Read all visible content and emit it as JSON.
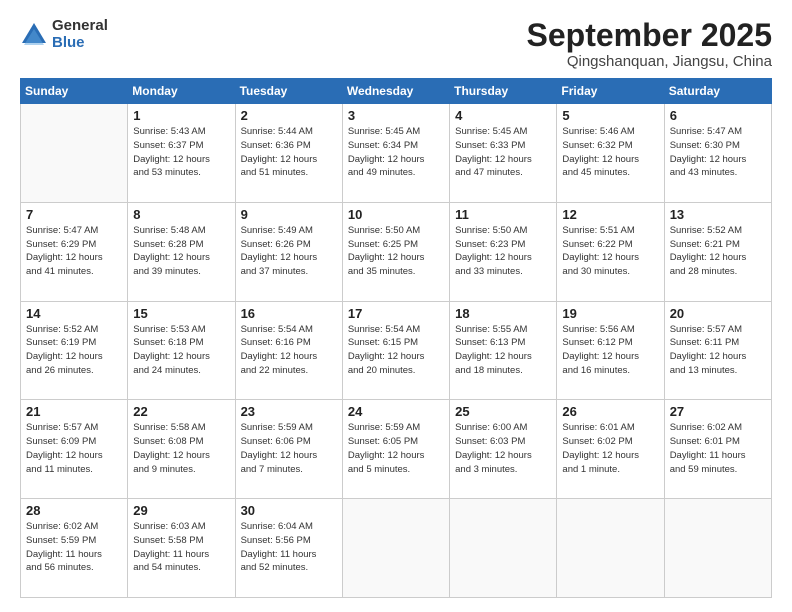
{
  "logo": {
    "general": "General",
    "blue": "Blue"
  },
  "title": {
    "month": "September 2025",
    "location": "Qingshanquan, Jiangsu, China"
  },
  "weekdays": [
    "Sunday",
    "Monday",
    "Tuesday",
    "Wednesday",
    "Thursday",
    "Friday",
    "Saturday"
  ],
  "weeks": [
    [
      {
        "day": "",
        "info": ""
      },
      {
        "day": "1",
        "info": "Sunrise: 5:43 AM\nSunset: 6:37 PM\nDaylight: 12 hours\nand 53 minutes."
      },
      {
        "day": "2",
        "info": "Sunrise: 5:44 AM\nSunset: 6:36 PM\nDaylight: 12 hours\nand 51 minutes."
      },
      {
        "day": "3",
        "info": "Sunrise: 5:45 AM\nSunset: 6:34 PM\nDaylight: 12 hours\nand 49 minutes."
      },
      {
        "day": "4",
        "info": "Sunrise: 5:45 AM\nSunset: 6:33 PM\nDaylight: 12 hours\nand 47 minutes."
      },
      {
        "day": "5",
        "info": "Sunrise: 5:46 AM\nSunset: 6:32 PM\nDaylight: 12 hours\nand 45 minutes."
      },
      {
        "day": "6",
        "info": "Sunrise: 5:47 AM\nSunset: 6:30 PM\nDaylight: 12 hours\nand 43 minutes."
      }
    ],
    [
      {
        "day": "7",
        "info": "Sunrise: 5:47 AM\nSunset: 6:29 PM\nDaylight: 12 hours\nand 41 minutes."
      },
      {
        "day": "8",
        "info": "Sunrise: 5:48 AM\nSunset: 6:28 PM\nDaylight: 12 hours\nand 39 minutes."
      },
      {
        "day": "9",
        "info": "Sunrise: 5:49 AM\nSunset: 6:26 PM\nDaylight: 12 hours\nand 37 minutes."
      },
      {
        "day": "10",
        "info": "Sunrise: 5:50 AM\nSunset: 6:25 PM\nDaylight: 12 hours\nand 35 minutes."
      },
      {
        "day": "11",
        "info": "Sunrise: 5:50 AM\nSunset: 6:23 PM\nDaylight: 12 hours\nand 33 minutes."
      },
      {
        "day": "12",
        "info": "Sunrise: 5:51 AM\nSunset: 6:22 PM\nDaylight: 12 hours\nand 30 minutes."
      },
      {
        "day": "13",
        "info": "Sunrise: 5:52 AM\nSunset: 6:21 PM\nDaylight: 12 hours\nand 28 minutes."
      }
    ],
    [
      {
        "day": "14",
        "info": "Sunrise: 5:52 AM\nSunset: 6:19 PM\nDaylight: 12 hours\nand 26 minutes."
      },
      {
        "day": "15",
        "info": "Sunrise: 5:53 AM\nSunset: 6:18 PM\nDaylight: 12 hours\nand 24 minutes."
      },
      {
        "day": "16",
        "info": "Sunrise: 5:54 AM\nSunset: 6:16 PM\nDaylight: 12 hours\nand 22 minutes."
      },
      {
        "day": "17",
        "info": "Sunrise: 5:54 AM\nSunset: 6:15 PM\nDaylight: 12 hours\nand 20 minutes."
      },
      {
        "day": "18",
        "info": "Sunrise: 5:55 AM\nSunset: 6:13 PM\nDaylight: 12 hours\nand 18 minutes."
      },
      {
        "day": "19",
        "info": "Sunrise: 5:56 AM\nSunset: 6:12 PM\nDaylight: 12 hours\nand 16 minutes."
      },
      {
        "day": "20",
        "info": "Sunrise: 5:57 AM\nSunset: 6:11 PM\nDaylight: 12 hours\nand 13 minutes."
      }
    ],
    [
      {
        "day": "21",
        "info": "Sunrise: 5:57 AM\nSunset: 6:09 PM\nDaylight: 12 hours\nand 11 minutes."
      },
      {
        "day": "22",
        "info": "Sunrise: 5:58 AM\nSunset: 6:08 PM\nDaylight: 12 hours\nand 9 minutes."
      },
      {
        "day": "23",
        "info": "Sunrise: 5:59 AM\nSunset: 6:06 PM\nDaylight: 12 hours\nand 7 minutes."
      },
      {
        "day": "24",
        "info": "Sunrise: 5:59 AM\nSunset: 6:05 PM\nDaylight: 12 hours\nand 5 minutes."
      },
      {
        "day": "25",
        "info": "Sunrise: 6:00 AM\nSunset: 6:03 PM\nDaylight: 12 hours\nand 3 minutes."
      },
      {
        "day": "26",
        "info": "Sunrise: 6:01 AM\nSunset: 6:02 PM\nDaylight: 12 hours\nand 1 minute."
      },
      {
        "day": "27",
        "info": "Sunrise: 6:02 AM\nSunset: 6:01 PM\nDaylight: 11 hours\nand 59 minutes."
      }
    ],
    [
      {
        "day": "28",
        "info": "Sunrise: 6:02 AM\nSunset: 5:59 PM\nDaylight: 11 hours\nand 56 minutes."
      },
      {
        "day": "29",
        "info": "Sunrise: 6:03 AM\nSunset: 5:58 PM\nDaylight: 11 hours\nand 54 minutes."
      },
      {
        "day": "30",
        "info": "Sunrise: 6:04 AM\nSunset: 5:56 PM\nDaylight: 11 hours\nand 52 minutes."
      },
      {
        "day": "",
        "info": ""
      },
      {
        "day": "",
        "info": ""
      },
      {
        "day": "",
        "info": ""
      },
      {
        "day": "",
        "info": ""
      }
    ]
  ]
}
